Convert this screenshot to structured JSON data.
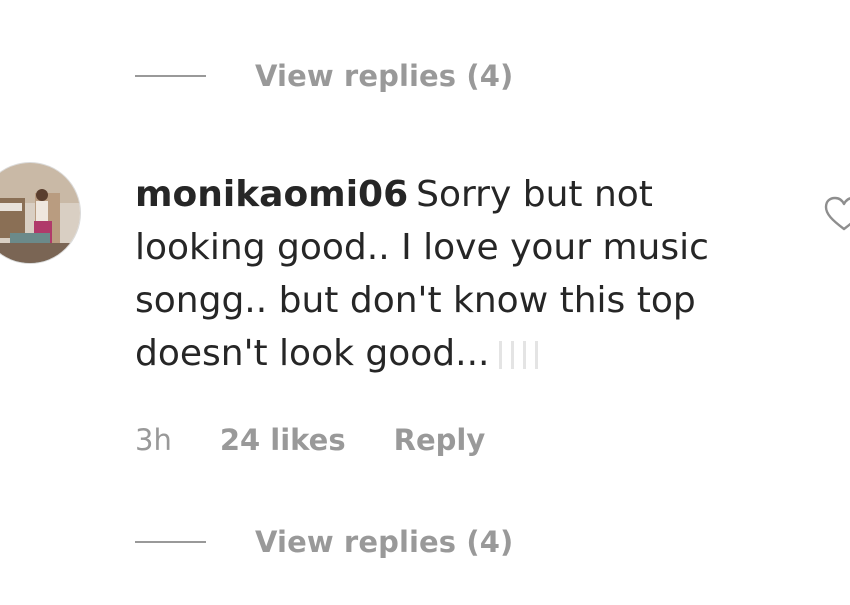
{
  "top_view_replies": {
    "label": "View replies (4)"
  },
  "comment": {
    "username": "monikaomi06",
    "text": "Sorry but not looking good.. I love your music songg.. but don't know this top doesn't look good...",
    "time": "3h",
    "likes": "24 likes",
    "reply_label": "Reply",
    "avatar_icon": "user-avatar",
    "like_icon": "heart-outline-icon"
  },
  "bottom_view_replies": {
    "label": "View replies (4)"
  },
  "colors": {
    "primary_text": "#262626",
    "secondary_text": "#999999"
  }
}
